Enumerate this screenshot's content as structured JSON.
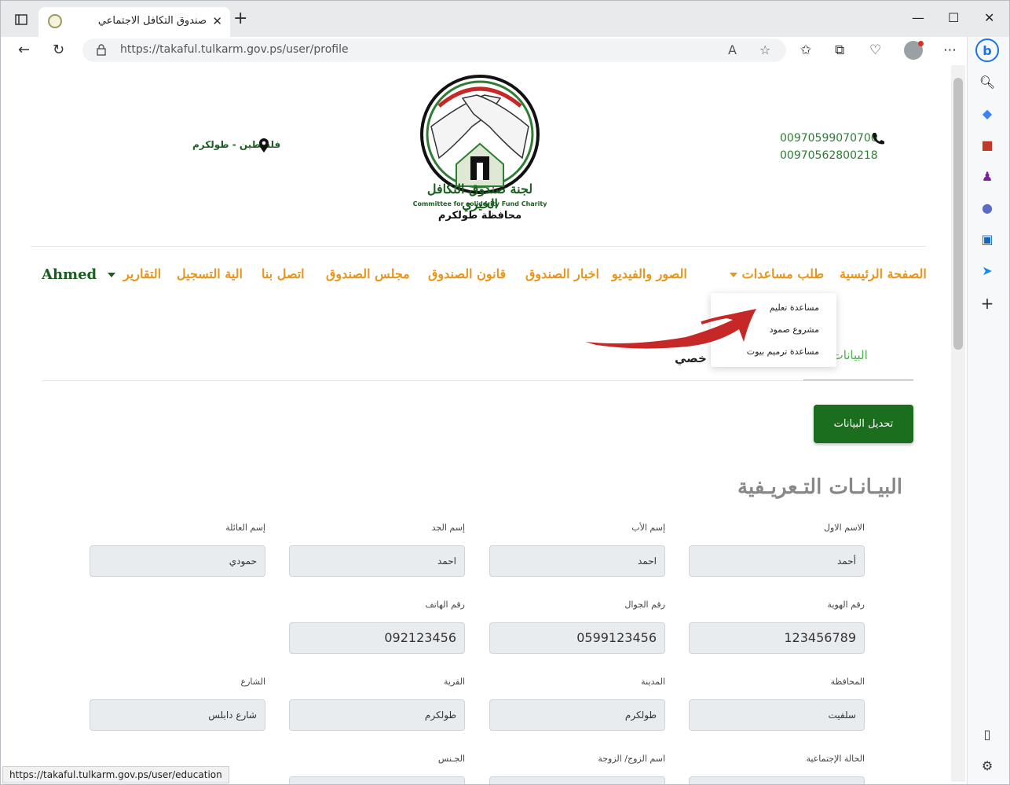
{
  "browser": {
    "tab_title": "صندوق التكافل الاجتماعي",
    "url": "https://takaful.tulkarm.gov.ps/user/profile",
    "status_url": "https://takaful.tulkarm.gov.ps/user/education"
  },
  "header": {
    "phone1": "00970599070700",
    "phone2": "00970562800218",
    "location": "فلسطين - طولكرم",
    "logo_title": "لجنة صندوق التكافل الخيري",
    "logo_subtitle": "Committee for solidarity Fund Charity",
    "logo_city": "محافظة طولكرم"
  },
  "menu": {
    "home": "الصفحة الرئيسية",
    "request_help": "طلب مساعدات",
    "media": "الصور والفيديو",
    "news": "اخبار الصندوق",
    "law": "قانون الصندوق",
    "council": "مجلس الصندوق",
    "contact": "اتصل بنا",
    "registration": "الية التسجيل",
    "reports": "التقارير",
    "user": "Ahmed"
  },
  "dropdown": {
    "items": [
      "مساعدة تعليم",
      "مشروع صمود",
      "مساعدة ترميم بيوت"
    ]
  },
  "profile_tabs": {
    "active": "البيانات الشخ",
    "other": "خصي"
  },
  "edit_button": "تحديل البيانات",
  "section_title": "البيـانـات التـعريـفية",
  "fields": {
    "first_name": {
      "label": "الاسم الاول",
      "value": "أحمد"
    },
    "father_name": {
      "label": "إسم الأب",
      "value": "احمد"
    },
    "grandfather_name": {
      "label": "إسم الجد",
      "value": "احمد"
    },
    "family_name": {
      "label": "إسم العائلة",
      "value": "حمودي"
    },
    "id_number": {
      "label": "رقم الهوية",
      "value": "123456789"
    },
    "mobile": {
      "label": "رقم الجوال",
      "value": "0599123456"
    },
    "phone": {
      "label": "رقم الهاتف",
      "value": "092123456"
    },
    "governorate": {
      "label": "المحافظة",
      "value": "سلفيت"
    },
    "city": {
      "label": "المدينة",
      "value": "طولكرم"
    },
    "village": {
      "label": "القرية",
      "value": "طولكرم"
    },
    "street": {
      "label": "الشارع",
      "value": "شارع دابلس"
    },
    "marital_status": {
      "label": "الحالة الإجتماعية"
    },
    "spouse_name": {
      "label": "اسم الزوج/ الزوجة"
    },
    "gender": {
      "label": "الجـنس"
    }
  },
  "colors": {
    "menu_orange": "#e8951c",
    "brand_green": "#1b6e1e",
    "annotation_red": "#c62828"
  }
}
